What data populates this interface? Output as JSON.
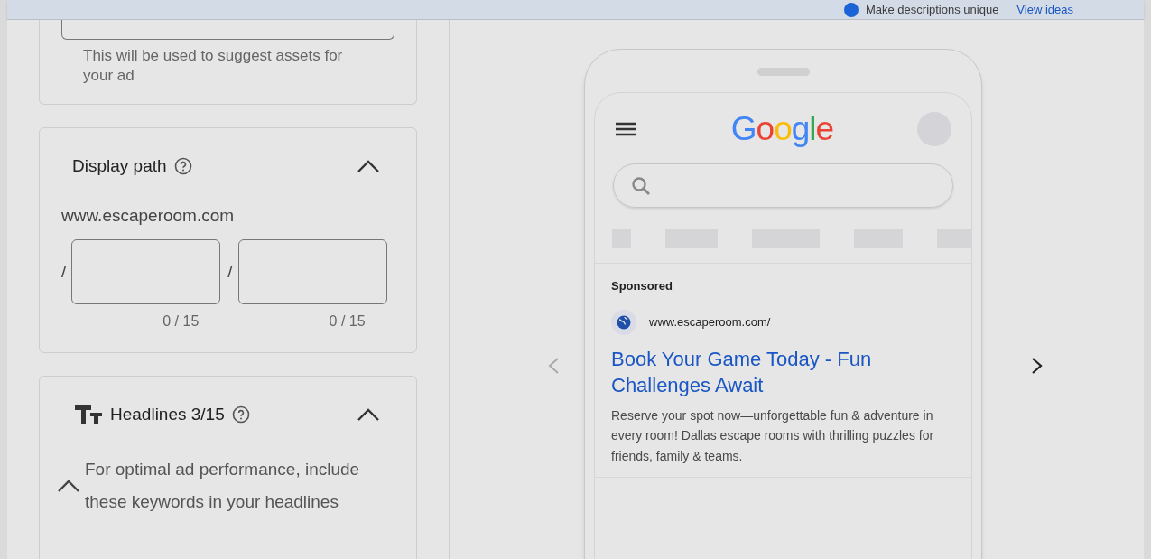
{
  "banner": {
    "text": "Make descriptions unique",
    "link": "View ideas"
  },
  "business_card": {
    "hint": "This will be used to suggest assets for your ad"
  },
  "display_path": {
    "title": "Display path",
    "expanded": true,
    "domain": "www.escaperoom.com",
    "separator": "/",
    "paths": [
      {
        "counter": "0 / 15"
      },
      {
        "counter": "0 / 15"
      }
    ]
  },
  "headlines": {
    "title": "Headlines 3/15",
    "expanded": true,
    "tip": "For optimal ad performance, include these keywords in your headlines",
    "tip_expanded": true
  },
  "preview": {
    "logo": [
      {
        "letter": "G",
        "color": "#4285f4"
      },
      {
        "letter": "o",
        "color": "#ea4335"
      },
      {
        "letter": "o",
        "color": "#fbbc05"
      },
      {
        "letter": "g",
        "color": "#4285f4"
      },
      {
        "letter": "l",
        "color": "#34a853"
      },
      {
        "letter": "e",
        "color": "#ea4335"
      }
    ],
    "ad": {
      "label": "Sponsored",
      "url": "www.escaperoom.com/",
      "headline": "Book Your Game Today - Fun Challenges Await",
      "description": "Reserve your spot now—unforgettable fun & adventure in every room! Dallas escape rooms with thrilling puzzles for friends, family & teams."
    }
  }
}
